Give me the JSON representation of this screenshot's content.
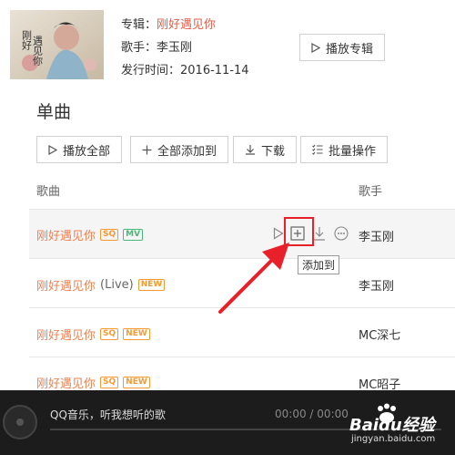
{
  "album": {
    "cover_lettering": "刚好遇见你",
    "album_label": "专辑：",
    "album_name": "刚好遇见你",
    "singer_label": "歌手：",
    "singer_name": "李玉刚",
    "release_label": "发行时间：",
    "release_date": "2016-11-14",
    "play_album_button": "播放专辑"
  },
  "section": {
    "title": "单曲"
  },
  "toolbar": {
    "play_all": "播放全部",
    "add_all": "全部添加到",
    "download": "下载",
    "batch": "批量操作"
  },
  "columns": {
    "song": "歌曲",
    "singer": "歌手"
  },
  "songs": [
    {
      "title": "刚好遇见你",
      "suffix": "",
      "tags": [
        "SQ",
        "MV"
      ],
      "singer": "李玉刚"
    },
    {
      "title": "刚好遇见你",
      "suffix": "(Live)",
      "tags": [
        "NEW"
      ],
      "singer": "李玉刚"
    },
    {
      "title": "刚好遇见你",
      "suffix": "",
      "tags": [
        "SQ",
        "NEW"
      ],
      "singer": "MC深七"
    },
    {
      "title": "刚好遇见你",
      "suffix": "",
      "tags": [
        "SQ",
        "NEW"
      ],
      "singer": "MC昭子"
    }
  ],
  "row_ops": {
    "tooltip": "添加到"
  },
  "player": {
    "now_playing": "QQ音乐，听我想听的歌",
    "current_time": "00:00",
    "separator": "/",
    "total_time": "00:00"
  },
  "watermark": {
    "brand": "Baidu经验",
    "url": "jingyan.baidu.com"
  },
  "colors": {
    "accent": "#f07f4d",
    "highlight_red": "#e8202a",
    "tag_sq": "#f49a32",
    "tag_mv": "#49b87a",
    "player_bg": "#1c1c1c"
  }
}
